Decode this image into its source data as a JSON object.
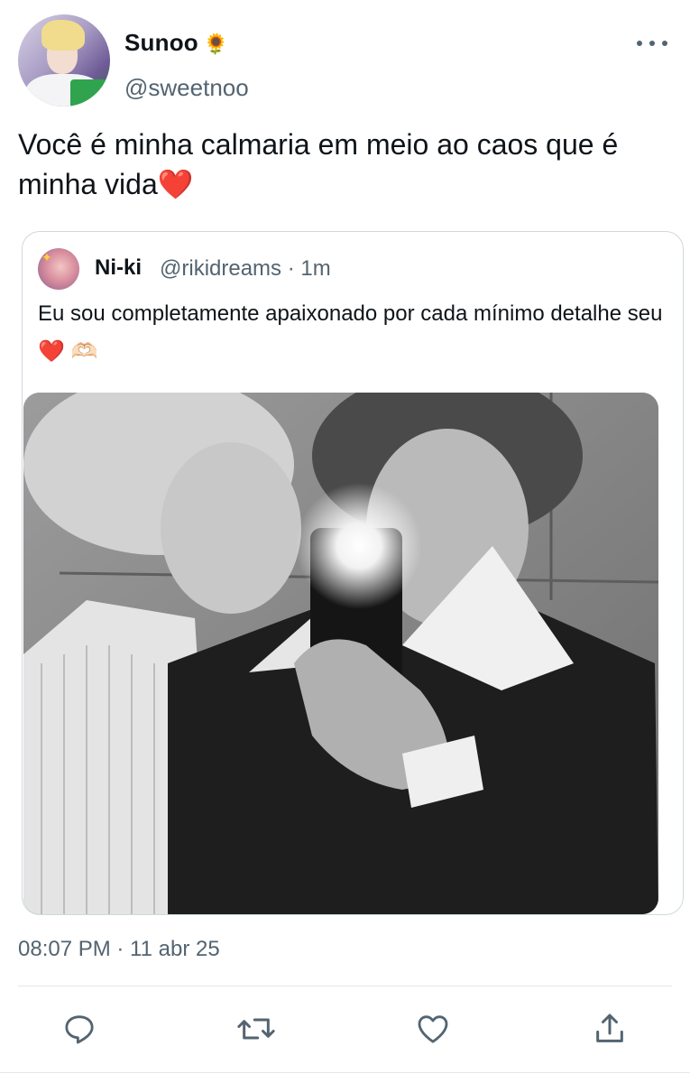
{
  "tweet": {
    "author": {
      "name": "Sunoo",
      "name_emoji": "🌻",
      "handle": "@sweetnoo"
    },
    "text": "Você é minha calmaria em meio ao caos que é minha vida❤️",
    "timestamp": "08:07 PM · 11 abr 25"
  },
  "quote": {
    "author": {
      "name": "Ni-ki",
      "handle": "@rikidreams · 1m"
    },
    "text": "Eu sou completamente apaixonado por cada mínimo detalhe seu ❤️ 🫶🏻",
    "media_alt": "black and white mirror selfie of two people"
  },
  "icons": {
    "more": "more-horizontal-icon",
    "reply": "reply-icon",
    "retweet": "retweet-icon",
    "like": "heart-icon",
    "share": "share-icon"
  },
  "colors": {
    "text": "#0f1419",
    "secondary": "#536471",
    "border": "#cfd9de"
  }
}
